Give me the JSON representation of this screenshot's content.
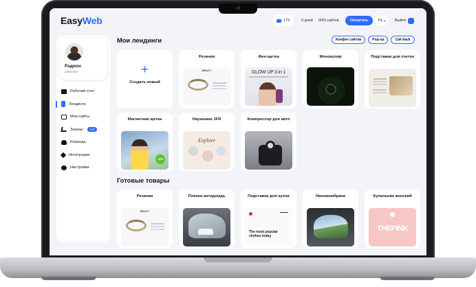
{
  "topbar": {
    "logo_main": "Easy",
    "logo_accent": "Web",
    "coins": "173",
    "days": "0 дней",
    "sites": "0/50 сайтов",
    "pay_label": "Оплатить",
    "language": "Ру",
    "logout_label": "Выйти"
  },
  "profile": {
    "name": "Радион",
    "id": "id985654"
  },
  "sidebar": {
    "items": [
      {
        "label": "Рабочий стол"
      },
      {
        "label": "Лендинги"
      },
      {
        "label": "Мои сайты"
      },
      {
        "label": "Заказы",
        "badge": "+12"
      },
      {
        "label": "Команда"
      },
      {
        "label": "Интеграции"
      },
      {
        "label": "Настройки"
      }
    ]
  },
  "landings": {
    "title": "Мои лендинги",
    "chips": [
      "Конфиг сайтов",
      "Pop-up",
      "Call-back"
    ],
    "create_label": "Создать новый",
    "cards": [
      {
        "title": "Резинки"
      },
      {
        "title": "Фен-щетка",
        "thumb_text": "GLOW UP 3 in 1"
      },
      {
        "title": "Монокуляр"
      },
      {
        "title": "Подставка для счеток"
      },
      {
        "title": "Магнитная щетка",
        "thumb_text": "-20%"
      },
      {
        "title": "Наушники JFR",
        "thumb_text": "Explore"
      },
      {
        "title": "Компрессор для авто"
      }
    ],
    "mini_brand": "BEAUTY"
  },
  "products": {
    "title": "Готовые товары",
    "cards": [
      {
        "title": "Резинки"
      },
      {
        "title": "Пленка антидождь"
      },
      {
        "title": "Подставка для кухни",
        "thumb_text": "The most popular clothes today"
      },
      {
        "title": "Наномембрана"
      },
      {
        "title": "Купальник женский",
        "thumb_text": "THEPINK"
      }
    ]
  },
  "colors": {
    "accent": "#2f6cf6",
    "background": "#f3f4f8",
    "text": "#13151c"
  }
}
